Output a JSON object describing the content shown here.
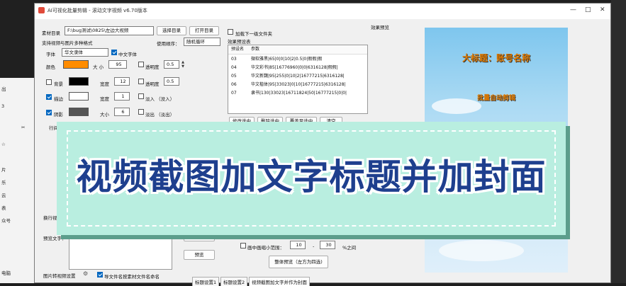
{
  "window": {
    "title": "AI可视化批量剪辑 - 滚动文字视频 v6.70版本",
    "minimize": "—",
    "maximize": "□",
    "close": "✕"
  },
  "left_strip": {
    "items": [
      "出",
      "3",
      "ぷ",
      "✂",
      "☆",
      "片",
      "乐",
      "云",
      "表",
      "☆",
      "众号",
      "☆",
      "☆",
      "电脑"
    ]
  },
  "material": {
    "label": "素材目录",
    "path": "F:\\bug测试\\0825\\左边大视频",
    "select_btn": "选择目录",
    "open_btn": "打开目录"
  },
  "support_text": "支持视频与图片多种格式",
  "use_order": {
    "label": "使用顺序：",
    "value": "随机循环"
  },
  "font": {
    "label": "字体",
    "value": "华文隶体",
    "chinese_font_label": "中文字体"
  },
  "color": {
    "label": "颜色",
    "value": "#ff8c00"
  },
  "size": {
    "label": "大 小",
    "value": "95"
  },
  "transparency": {
    "label": "透明度",
    "value": "0.5"
  },
  "background": {
    "label": "背景",
    "value": "#000000",
    "width_label": "宽度",
    "width_value": "12",
    "transparency_label": "透明度",
    "transparency_value": "0.5"
  },
  "stroke": {
    "label": "描边",
    "value": "#ffffff",
    "width_label": "宽度",
    "width_value": "1",
    "fadein_label": "淡入 （没入）"
  },
  "shadow": {
    "label": "阴影",
    "value": "#555555",
    "size_label": "大小",
    "size_value": "6",
    "fadeout_label": "淡出 （淡出）"
  },
  "row_label": "行间",
  "load_subfolder": "加载下一级文件夹",
  "presets": {
    "label": "效果预设表",
    "headers": [
      "预设名",
      "参数"
    ],
    "rows": [
      [
        "03",
        "微软雅黑|65|0|0|10|2|0.5|0|假假|假"
      ],
      [
        "04",
        "华文彩书|85|16776960|0|0|6316128|假假|"
      ],
      [
        "05",
        "华文新魏|95|255|0|10|2|16777215|6316128|"
      ],
      [
        "06",
        "华文楷体|95|33023|0|10|16777215|6316128|"
      ],
      [
        "07",
        "隶书|130|33023|16711824|50|16777215|0|0|"
      ]
    ]
  },
  "preset_buttons": [
    "修改选中",
    "删除选中",
    "覆盖至选中",
    "清空"
  ],
  "preview": {
    "label": "效果预览",
    "title_text": "大标题：账号名称",
    "sub_text": "批量自动剪辑"
  },
  "banner": {
    "text": "视频截图加文字标题并加封面"
  },
  "switch_video": "换行视频",
  "preview_text_label": "预览文字：",
  "save_preset": "存为预设",
  "preview_btn": "预览",
  "range": {
    "label": "画中画缩小范围：",
    "from": "10",
    "sep": "-",
    "to": "30",
    "unit": "%之间"
  },
  "overall_preview": "整体预览（左方为四选)",
  "bottom": {
    "pic_to_video": "图片转视频设置",
    "export_label": "导文件名按素材文件名命名"
  },
  "tabs": [
    "标题设置1",
    "标题设置2",
    "视频截图加文字并作为封面"
  ]
}
